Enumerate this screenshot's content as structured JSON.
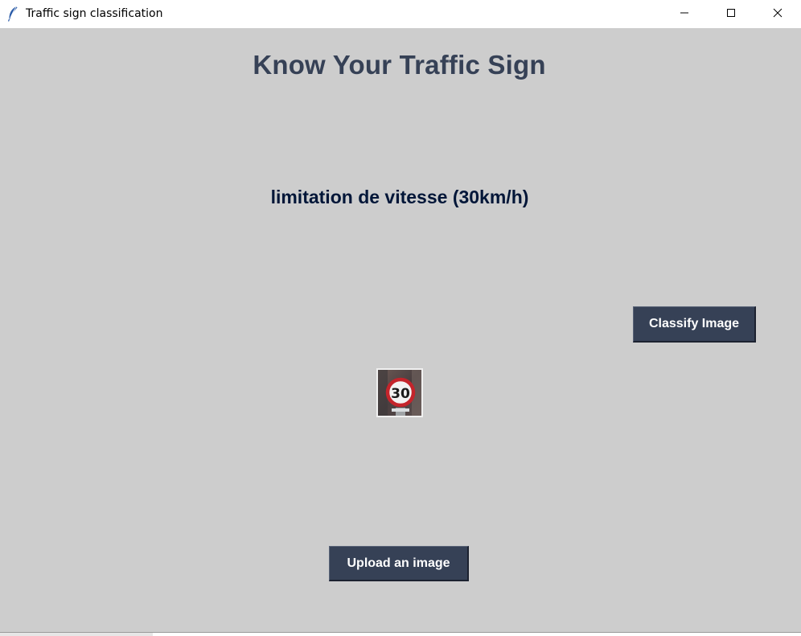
{
  "window": {
    "title": "Traffic sign classification",
    "icon": "feather-icon",
    "controls": {
      "minimize_icon": "minimize-icon",
      "maximize_icon": "maximize-icon",
      "close_icon": "close-icon"
    }
  },
  "main": {
    "heading": "Know Your Traffic Sign",
    "prediction": "limitation de vitesse (30km/h)",
    "classify_label": "Classify Image",
    "upload_label": "Upload an image",
    "sign_image": {
      "speed_limit_text": "30",
      "icon": "speed-limit-sign-image"
    }
  },
  "colors": {
    "background": "#cdcdcd",
    "heading": "#364156",
    "prediction": "#011638",
    "button_bg": "#364156",
    "button_text": "#ffffff"
  }
}
